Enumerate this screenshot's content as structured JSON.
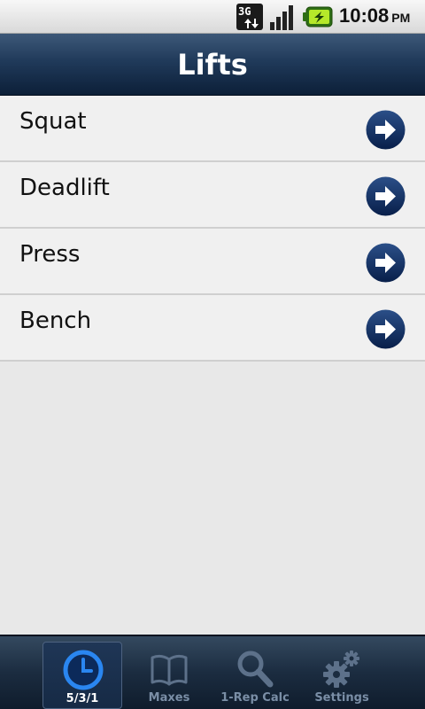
{
  "status_bar": {
    "network": "3G",
    "time": "10:08",
    "ampm": "PM",
    "icons": [
      "network-3g-icon",
      "signal-icon",
      "battery-charging-icon"
    ]
  },
  "header": {
    "title": "Lifts"
  },
  "lifts": [
    {
      "label": "Squat",
      "icon": "arrow-right-icon"
    },
    {
      "label": "Deadlift",
      "icon": "arrow-right-icon"
    },
    {
      "label": "Press",
      "icon": "arrow-right-icon"
    },
    {
      "label": "Bench",
      "icon": "arrow-right-icon"
    }
  ],
  "tabs": [
    {
      "label": "5/3/1",
      "icon": "clock-icon",
      "selected": true
    },
    {
      "label": "Maxes",
      "icon": "book-icon",
      "selected": false
    },
    {
      "label": "1-Rep Calc",
      "icon": "magnifier-icon",
      "selected": false
    },
    {
      "label": "Settings",
      "icon": "gears-icon",
      "selected": false
    }
  ],
  "colors": {
    "title_bar": "#203a5a",
    "tab_bar": "#1b2c40",
    "arrow_button": "#0f2b5c",
    "selected_tab_icon": "#1e6fd9",
    "inactive_tab": "#5d718a"
  }
}
